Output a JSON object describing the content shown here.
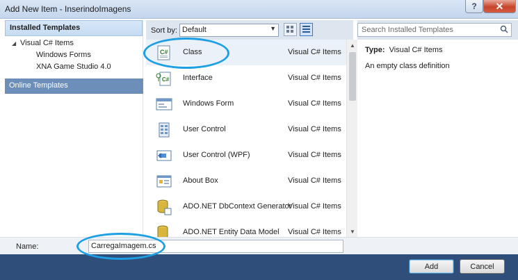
{
  "window": {
    "title": "Add New Item - InserindoImagens",
    "help_label": "?",
    "close_label": "✕"
  },
  "left_panel": {
    "header": "Installed Templates",
    "tree": [
      {
        "label": "Visual C# Items",
        "level": 0
      },
      {
        "label": "Windows Forms",
        "level": 1
      },
      {
        "label": "XNA Game Studio 4.0",
        "level": 1
      }
    ],
    "online": "Online Templates"
  },
  "toolbar": {
    "sort_label": "Sort by:",
    "sort_value": "Default"
  },
  "templates": [
    {
      "name": "Class",
      "type": "Visual C# Items",
      "icon": "class-icon",
      "selected": true
    },
    {
      "name": "Interface",
      "type": "Visual C# Items",
      "icon": "interface-icon"
    },
    {
      "name": "Windows Form",
      "type": "Visual C# Items",
      "icon": "windows-form-icon"
    },
    {
      "name": "User Control",
      "type": "Visual C# Items",
      "icon": "user-control-icon"
    },
    {
      "name": "User Control (WPF)",
      "type": "Visual C# Items",
      "icon": "user-control-wpf-icon"
    },
    {
      "name": "About Box",
      "type": "Visual C# Items",
      "icon": "about-box-icon"
    },
    {
      "name": "ADO.NET DbContext Generator",
      "type": "Visual C# Items",
      "icon": "dbcontext-icon"
    },
    {
      "name": "ADO.NET Entity Data Model",
      "type": "Visual C# Items",
      "icon": "entity-model-icon"
    }
  ],
  "search": {
    "placeholder": "Search Installed Templates"
  },
  "description": {
    "type_label": "Type:",
    "type_value": "Visual C# Items",
    "text": "An empty class definition"
  },
  "name_field": {
    "label": "Name:",
    "value": "CarregaImagem.cs"
  },
  "buttons": {
    "add": "Add",
    "cancel": "Cancel"
  },
  "colors": {
    "highlight_oval": "#1d9fe4",
    "selection": "#6d8eb9",
    "button_bar": "#2f4e7a"
  }
}
